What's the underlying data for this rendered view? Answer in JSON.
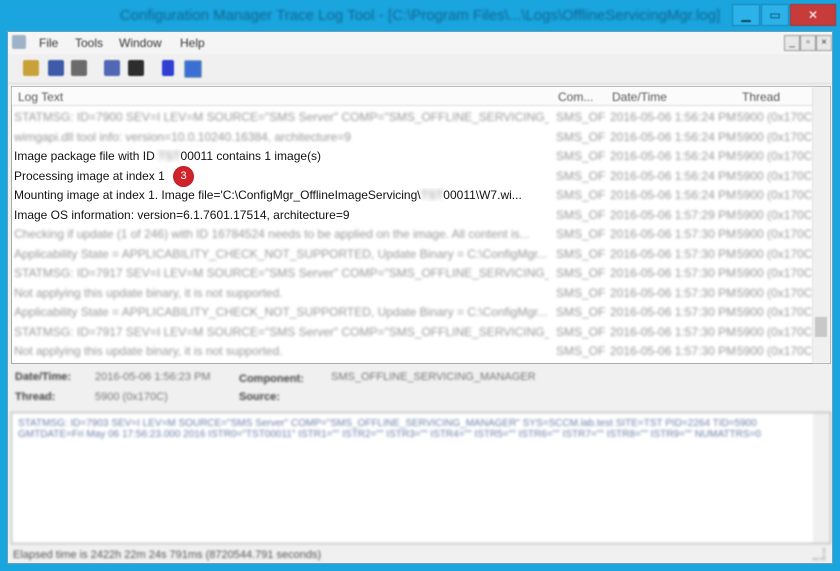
{
  "window": {
    "title": "Configuration Manager Trace Log Tool - [C:\\Program Files\\...\\Logs\\OfflineServicingMgr.log]",
    "controls": {
      "minimize": "▁",
      "maximize": "▭",
      "close": "✕"
    }
  },
  "menubar": {
    "items": [
      "File",
      "Tools",
      "Window",
      "Help"
    ],
    "mdi_controls": [
      "_",
      "▫",
      "×"
    ]
  },
  "toolbar": {
    "tools": [
      "open-icon",
      "print-icon",
      "save-icon",
      "copy-icon",
      "find-icon",
      "pause-icon",
      "highlight-icon"
    ]
  },
  "list": {
    "columns": [
      "Log Text",
      "Com...",
      "Date/Time",
      "Thread"
    ],
    "rows": [
      {
        "msg": "STATMSG: ID=7900 SEV=I LEV=M SOURCE=\"SMS Server\" COMP=\"SMS_OFFLINE_SERVICING_M...",
        "comp": "SMS_OFF",
        "dt": "2016-05-06 1:56:24 PM",
        "th": "5900 (0x170C)",
        "clear": false
      },
      {
        "msg": "wimgapi.dll tool info: version=10.0.10240.16384, architecture=9",
        "comp": "SMS_OFF",
        "dt": "2016-05-06 1:56:24 PM",
        "th": "5900 (0x170C)",
        "clear": false
      },
      {
        "msg_pre": "Image package file with ID ",
        "msg_redact": "TST",
        "msg_post": "00011 contains 1 image(s)",
        "comp": "SMS_OFF",
        "dt": "2016-05-06 1:56:24 PM",
        "th": "5900 (0x170C)",
        "clear": true
      },
      {
        "msg": "Processing image at index 1",
        "comp": "SMS_OFF",
        "dt": "2016-05-06 1:56:24 PM",
        "th": "5900 (0x170C)",
        "clear": true,
        "badge": "3"
      },
      {
        "msg_pre": "Mounting image at index 1. Image file='C:\\ConfigMgr_OfflineImageServicing\\",
        "msg_redact": "TST",
        "msg_post": "00011\\W7.wi...",
        "comp": "SMS_OFF",
        "dt": "2016-05-06 1:56:24 PM",
        "th": "5900 (0x170C)",
        "clear": true
      },
      {
        "msg": "Image OS information: version=6.1.7601.17514, architecture=9",
        "comp": "SMS_OFF",
        "dt": "2016-05-06 1:57:29 PM",
        "th": "5900 (0x170C)",
        "clear": true
      },
      {
        "msg": "Checking if update (1 of 246) with ID 16784524 needs to be applied on the image. All content is...",
        "comp": "SMS_OFF",
        "dt": "2016-05-06 1:57:30 PM",
        "th": "5900 (0x170C)",
        "clear": false
      },
      {
        "msg": "Applicability State = APPLICABILITY_CHECK_NOT_SUPPORTED, Update Binary = C:\\ConfigMgr...",
        "comp": "SMS_OFF",
        "dt": "2016-05-06 1:57:30 PM",
        "th": "5900 (0x170C)",
        "clear": false
      },
      {
        "msg": "STATMSG: ID=7917 SEV=I LEV=M SOURCE=\"SMS Server\" COMP=\"SMS_OFFLINE_SERVICING_M...",
        "comp": "SMS_OFF",
        "dt": "2016-05-06 1:57:30 PM",
        "th": "5900 (0x170C)",
        "clear": false
      },
      {
        "msg": "Not applying this update binary, it is not supported.",
        "comp": "SMS_OFF",
        "dt": "2016-05-06 1:57:30 PM",
        "th": "5900 (0x170C)",
        "clear": false
      },
      {
        "msg": "Applicability State = APPLICABILITY_CHECK_NOT_SUPPORTED, Update Binary = C:\\ConfigMgr...",
        "comp": "SMS_OFF",
        "dt": "2016-05-06 1:57:30 PM",
        "th": "5900 (0x170C)",
        "clear": false
      },
      {
        "msg": "STATMSG: ID=7917 SEV=I LEV=M SOURCE=\"SMS Server\" COMP=\"SMS_OFFLINE_SERVICING_M...",
        "comp": "SMS_OFF",
        "dt": "2016-05-06 1:57:30 PM",
        "th": "5900 (0x170C)",
        "clear": false
      },
      {
        "msg": "Not applying this update binary, it is not supported.",
        "comp": "SMS_OFF",
        "dt": "2016-05-06 1:57:30 PM",
        "th": "5900 (0x170C)",
        "clear": false
      }
    ]
  },
  "details": {
    "datetime_label": "Date/Time:",
    "datetime_value": "2016-05-06 1:56:23 PM",
    "component_label": "Component:",
    "component_value": "SMS_OFFLINE_SERVICING_MANAGER",
    "thread_label": "Thread:",
    "thread_value": "5900 (0x170C)",
    "source_label": "Source:"
  },
  "message": {
    "text": "STATMSG: ID=7903 SEV=I LEV=M SOURCE=\"SMS Server\" COMP=\"SMS_OFFLINE_SERVICING_MANAGER\" SYS=SCCM.lab.test SITE=TST PID=2264 TID=5900 GMTDATE=Fri May 06 17:56:23.000 2016 ISTR0=\"TST00011\" ISTR1=\"\" ISTR2=\"\" ISTR3=\"\" ISTR4=\"\" ISTR5=\"\" ISTR6=\"\" ISTR7=\"\" ISTR8=\"\" ISTR9=\"\" NUMATTRS=0"
  },
  "status": {
    "text": "Elapsed time is 2422h 22m 24s 791ms (8720544.791 seconds)"
  }
}
